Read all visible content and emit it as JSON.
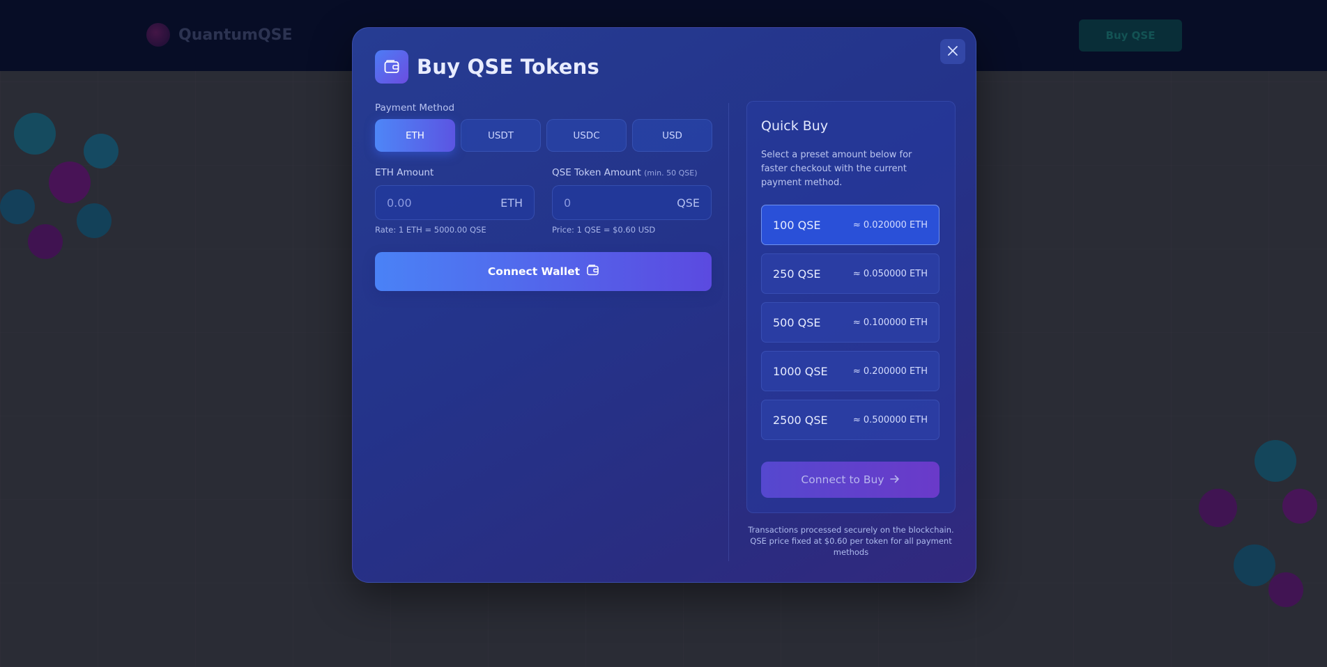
{
  "background": {
    "brand": "QuantumQSE",
    "cta_label": "Buy QSE"
  },
  "modal": {
    "title": "Buy QSE Tokens",
    "close_icon": "close-icon",
    "header_icon": "wallet-icon"
  },
  "payment": {
    "label": "Payment Method",
    "methods": [
      "ETH",
      "USDT",
      "USDC",
      "USD"
    ],
    "selected": "ETH"
  },
  "eth_field": {
    "label": "ETH Amount",
    "placeholder": "0.00",
    "unit": "ETH",
    "hint": "Rate: 1 ETH = 5000.00 QSE"
  },
  "qse_field": {
    "label": "QSE Token Amount",
    "sublabel": "(min. 50 QSE)",
    "placeholder": "0",
    "unit": "QSE",
    "hint": "Price: 1 QSE = $0.60 USD"
  },
  "connect_wallet_label": "Connect Wallet",
  "quick_buy": {
    "title": "Quick Buy",
    "description": "Select a preset amount below for faster checkout with the current payment method.",
    "options": [
      {
        "amount": "100 QSE",
        "equivalent": "≈ 0.020000 ETH"
      },
      {
        "amount": "250 QSE",
        "equivalent": "≈ 0.050000 ETH"
      },
      {
        "amount": "500 QSE",
        "equivalent": "≈ 0.100000 ETH"
      },
      {
        "amount": "1000 QSE",
        "equivalent": "≈ 0.200000 ETH"
      },
      {
        "amount": "2500 QSE",
        "equivalent": "≈ 0.500000 ETH"
      }
    ],
    "selected_option": "100 QSE",
    "connect_label": "Connect to Buy"
  },
  "footnote": {
    "line1": "Transactions processed securely on the blockchain.",
    "line2": "QSE price fixed at $0.60 per token for all payment methods"
  },
  "colors": {
    "accent_blue": "#4e86f7",
    "accent_purple": "#5b4ae0",
    "modal_bg": "#25368c"
  }
}
